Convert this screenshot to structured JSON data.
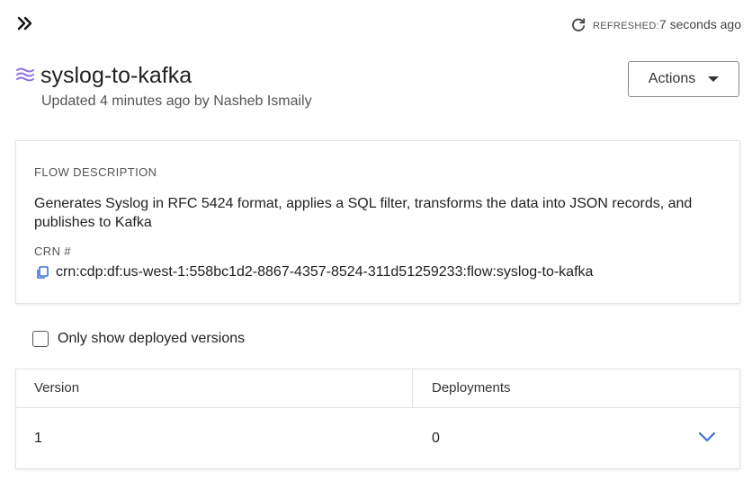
{
  "toolbar": {
    "refresh_label": "REFRESHED:",
    "refresh_value": "7 seconds ago"
  },
  "flow": {
    "name": "syslog-to-kafka",
    "updated": "Updated 4 minutes ago by Nasheb Ismaily",
    "actions_label": "Actions"
  },
  "details": {
    "description_label": "FLOW DESCRIPTION",
    "description": "Generates Syslog in RFC 5424 format, applies a SQL filter, transforms the data into JSON records, and publishes to Kafka",
    "crn_label": "CRN #",
    "crn": "crn:cdp:df:us-west-1:558bc1d2-8867-4357-8524-311d51259233:flow:syslog-to-kafka"
  },
  "filter": {
    "only_deployed_label": "Only show deployed versions",
    "checked": false
  },
  "table": {
    "columns": [
      "Version",
      "Deployments"
    ],
    "rows": [
      {
        "version": "1",
        "deployments": "0"
      }
    ]
  },
  "colors": {
    "accent": "#3b6fd6",
    "flow_icon": "#8e6fe0"
  }
}
